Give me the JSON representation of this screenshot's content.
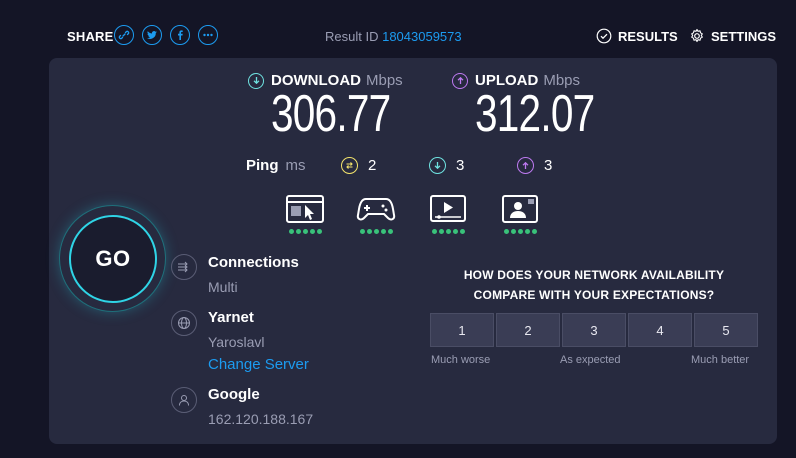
{
  "header": {
    "share_label": "SHARE",
    "result_label": "Result ID",
    "result_id": "18043059573",
    "results_label": "RESULTS",
    "settings_label": "SETTINGS"
  },
  "speeds": {
    "download": {
      "label": "DOWNLOAD",
      "unit": "Mbps",
      "value": "306.77"
    },
    "upload": {
      "label": "UPLOAD",
      "unit": "Mbps",
      "value": "312.07"
    }
  },
  "ping": {
    "label": "Ping",
    "unit": "ms",
    "idle": "2",
    "download": "3",
    "upload": "3"
  },
  "usecases": [
    {
      "icon": "browsing-icon",
      "rating": 5
    },
    {
      "icon": "gaming-icon",
      "rating": 5
    },
    {
      "icon": "video-streaming-icon",
      "rating": 5
    },
    {
      "icon": "video-chat-icon",
      "rating": 5
    }
  ],
  "go_label": "GO",
  "connections": {
    "title": "Connections",
    "value": "Multi"
  },
  "server": {
    "name": "Yarnet",
    "location": "Yaroslavl",
    "change_label": "Change Server"
  },
  "provider": {
    "name": "Google",
    "ip": "162.120.188.167"
  },
  "survey": {
    "question_line1": "HOW DOES YOUR NETWORK AVAILABILITY",
    "question_line2": "COMPARE WITH YOUR EXPECTATIONS?",
    "options": [
      "1",
      "2",
      "3",
      "4",
      "5"
    ],
    "low_label": "Much worse",
    "mid_label": "As expected",
    "high_label": "Much better"
  },
  "colors": {
    "accent_blue": "#1c9bf0",
    "download_cyan": "#6fe3e1",
    "upload_purple": "#bd79f0",
    "ping_yellow": "#f3e36b",
    "rating_green": "#39c27a"
  }
}
